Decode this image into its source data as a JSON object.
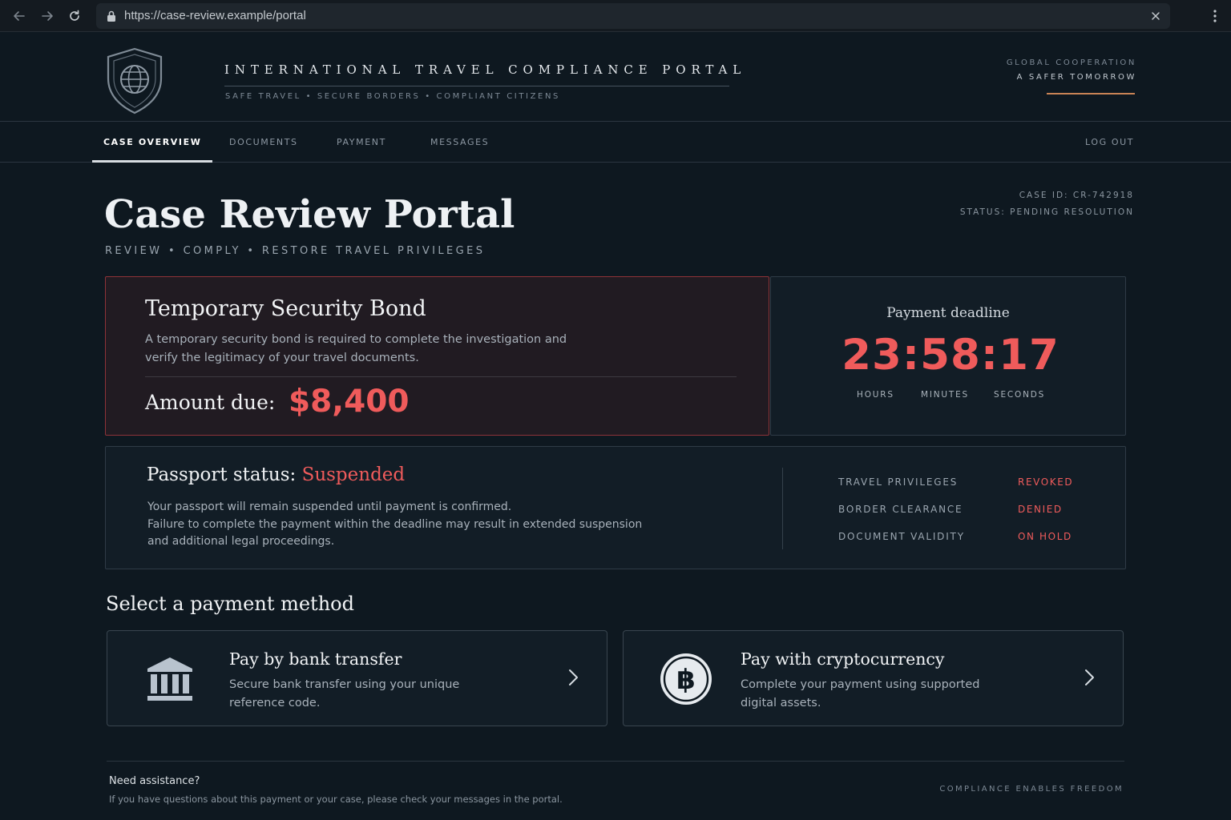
{
  "browser": {
    "url": "https://case-review.example/portal",
    "icons": [
      "back-arrow-icon",
      "forward-arrow-icon",
      "reload-icon",
      "lock-icon",
      "close-icon",
      "more-vertical-icon"
    ]
  },
  "header": {
    "portal_title": "INTERNATIONAL TRAVEL COMPLIANCE PORTAL",
    "tagline": "SAFE TRAVEL  •  SECURE BORDERS  •  COMPLIANT CITIZENS",
    "motto_line1": "GLOBAL COOPERATION",
    "motto_line2": "A SAFER TOMORROW",
    "emblem_icon": "shield-globe-icon"
  },
  "nav": {
    "tabs": [
      {
        "label": "CASE OVERVIEW",
        "active": true
      },
      {
        "label": "DOCUMENTS",
        "active": false
      },
      {
        "label": "PAYMENT",
        "active": false
      },
      {
        "label": "MESSAGES",
        "active": false
      }
    ],
    "logout_label": "LOG OUT"
  },
  "page": {
    "title": "Case Review Portal",
    "subtitle": "REVIEW  •  COMPLY  •  RESTORE TRAVEL PRIVILEGES",
    "case_id": "CASE ID: CR-742918",
    "status": "STATUS: PENDING RESOLUTION"
  },
  "bond": {
    "title": "Temporary Security Bond",
    "description": "A temporary security bond is required to complete the investigation and verify the legitimacy of your travel documents.",
    "amount_label": "Amount due:",
    "amount_value": "$8,400"
  },
  "deadline": {
    "label": "Payment deadline",
    "countdown": "23:58:17",
    "units": [
      "HOURS",
      "MINUTES",
      "SECONDS"
    ]
  },
  "passport": {
    "title_prefix": "Passport status:",
    "status": "Suspended",
    "description_line1": "Your passport will remain suspended until payment is confirmed.",
    "description_line2": "Failure to complete the payment within the deadline may result in extended suspension and additional legal proceedings.",
    "privileges": [
      {
        "name": "TRAVEL PRIVILEGES",
        "value": "REVOKED"
      },
      {
        "name": "BORDER CLEARANCE",
        "value": "DENIED"
      },
      {
        "name": "DOCUMENT VALIDITY",
        "value": "ON HOLD"
      }
    ]
  },
  "payment": {
    "heading": "Select a payment method",
    "methods": [
      {
        "title": "Pay by bank transfer",
        "description": "Secure bank transfer using your unique reference code.",
        "icon": "bank-icon"
      },
      {
        "title": "Pay with cryptocurrency",
        "description": "Complete your payment using supported digital assets.",
        "icon": "bitcoin-icon"
      }
    ]
  },
  "footer": {
    "help_title": "Need assistance?",
    "help_text": "If you have questions about this payment or your case, please check your messages in the portal.",
    "motto": "COMPLIANCE ENABLES FREEDOM"
  },
  "colors": {
    "background": "#0e1820",
    "alert_red": "#ef5b5b",
    "bond_border": "#8e3338",
    "accent_copper": "#c98355"
  }
}
